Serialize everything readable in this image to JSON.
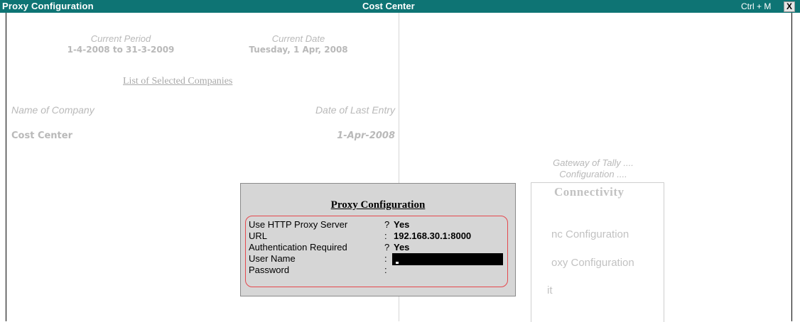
{
  "titlebar": {
    "left_title": "Proxy Configuration",
    "center_title": "Cost Center",
    "shortcut": "Ctrl + M",
    "close_glyph": "X"
  },
  "info": {
    "current_period_label": "Current Period",
    "current_period_value": "1-4-2008 to 31-3-2009",
    "current_date_label": "Current Date",
    "current_date_value": "Tuesday, 1 Apr, 2008"
  },
  "companies": {
    "heading": "List of Selected Companies",
    "col_name": "Name of Company",
    "col_date": "Date of Last Entry",
    "rows": [
      {
        "name": "Cost Center",
        "date": "1-Apr-2008"
      }
    ]
  },
  "gateway": {
    "line1": "Gateway of Tally ....",
    "line2": "Configuration ....",
    "menu_title": "Connectivity",
    "items": [
      "nc Configuration",
      "oxy Configuration",
      "it"
    ]
  },
  "dialog": {
    "title": "Proxy Configuration",
    "fields": [
      {
        "label": "Use HTTP Proxy Server",
        "sep": "?",
        "value": "Yes"
      },
      {
        "label": "URL",
        "sep": ":",
        "value": "192.168.30.1:8000"
      },
      {
        "label": "Authentication Required",
        "sep": "?",
        "value": "Yes"
      },
      {
        "label": "User Name",
        "sep": ":",
        "value": ""
      },
      {
        "label": "Password",
        "sep": ":",
        "value": ""
      }
    ]
  },
  "colors": {
    "titlebar": "#0e7474",
    "dialog_bg": "#d6d6d6",
    "highlight_border": "#e5484d"
  }
}
